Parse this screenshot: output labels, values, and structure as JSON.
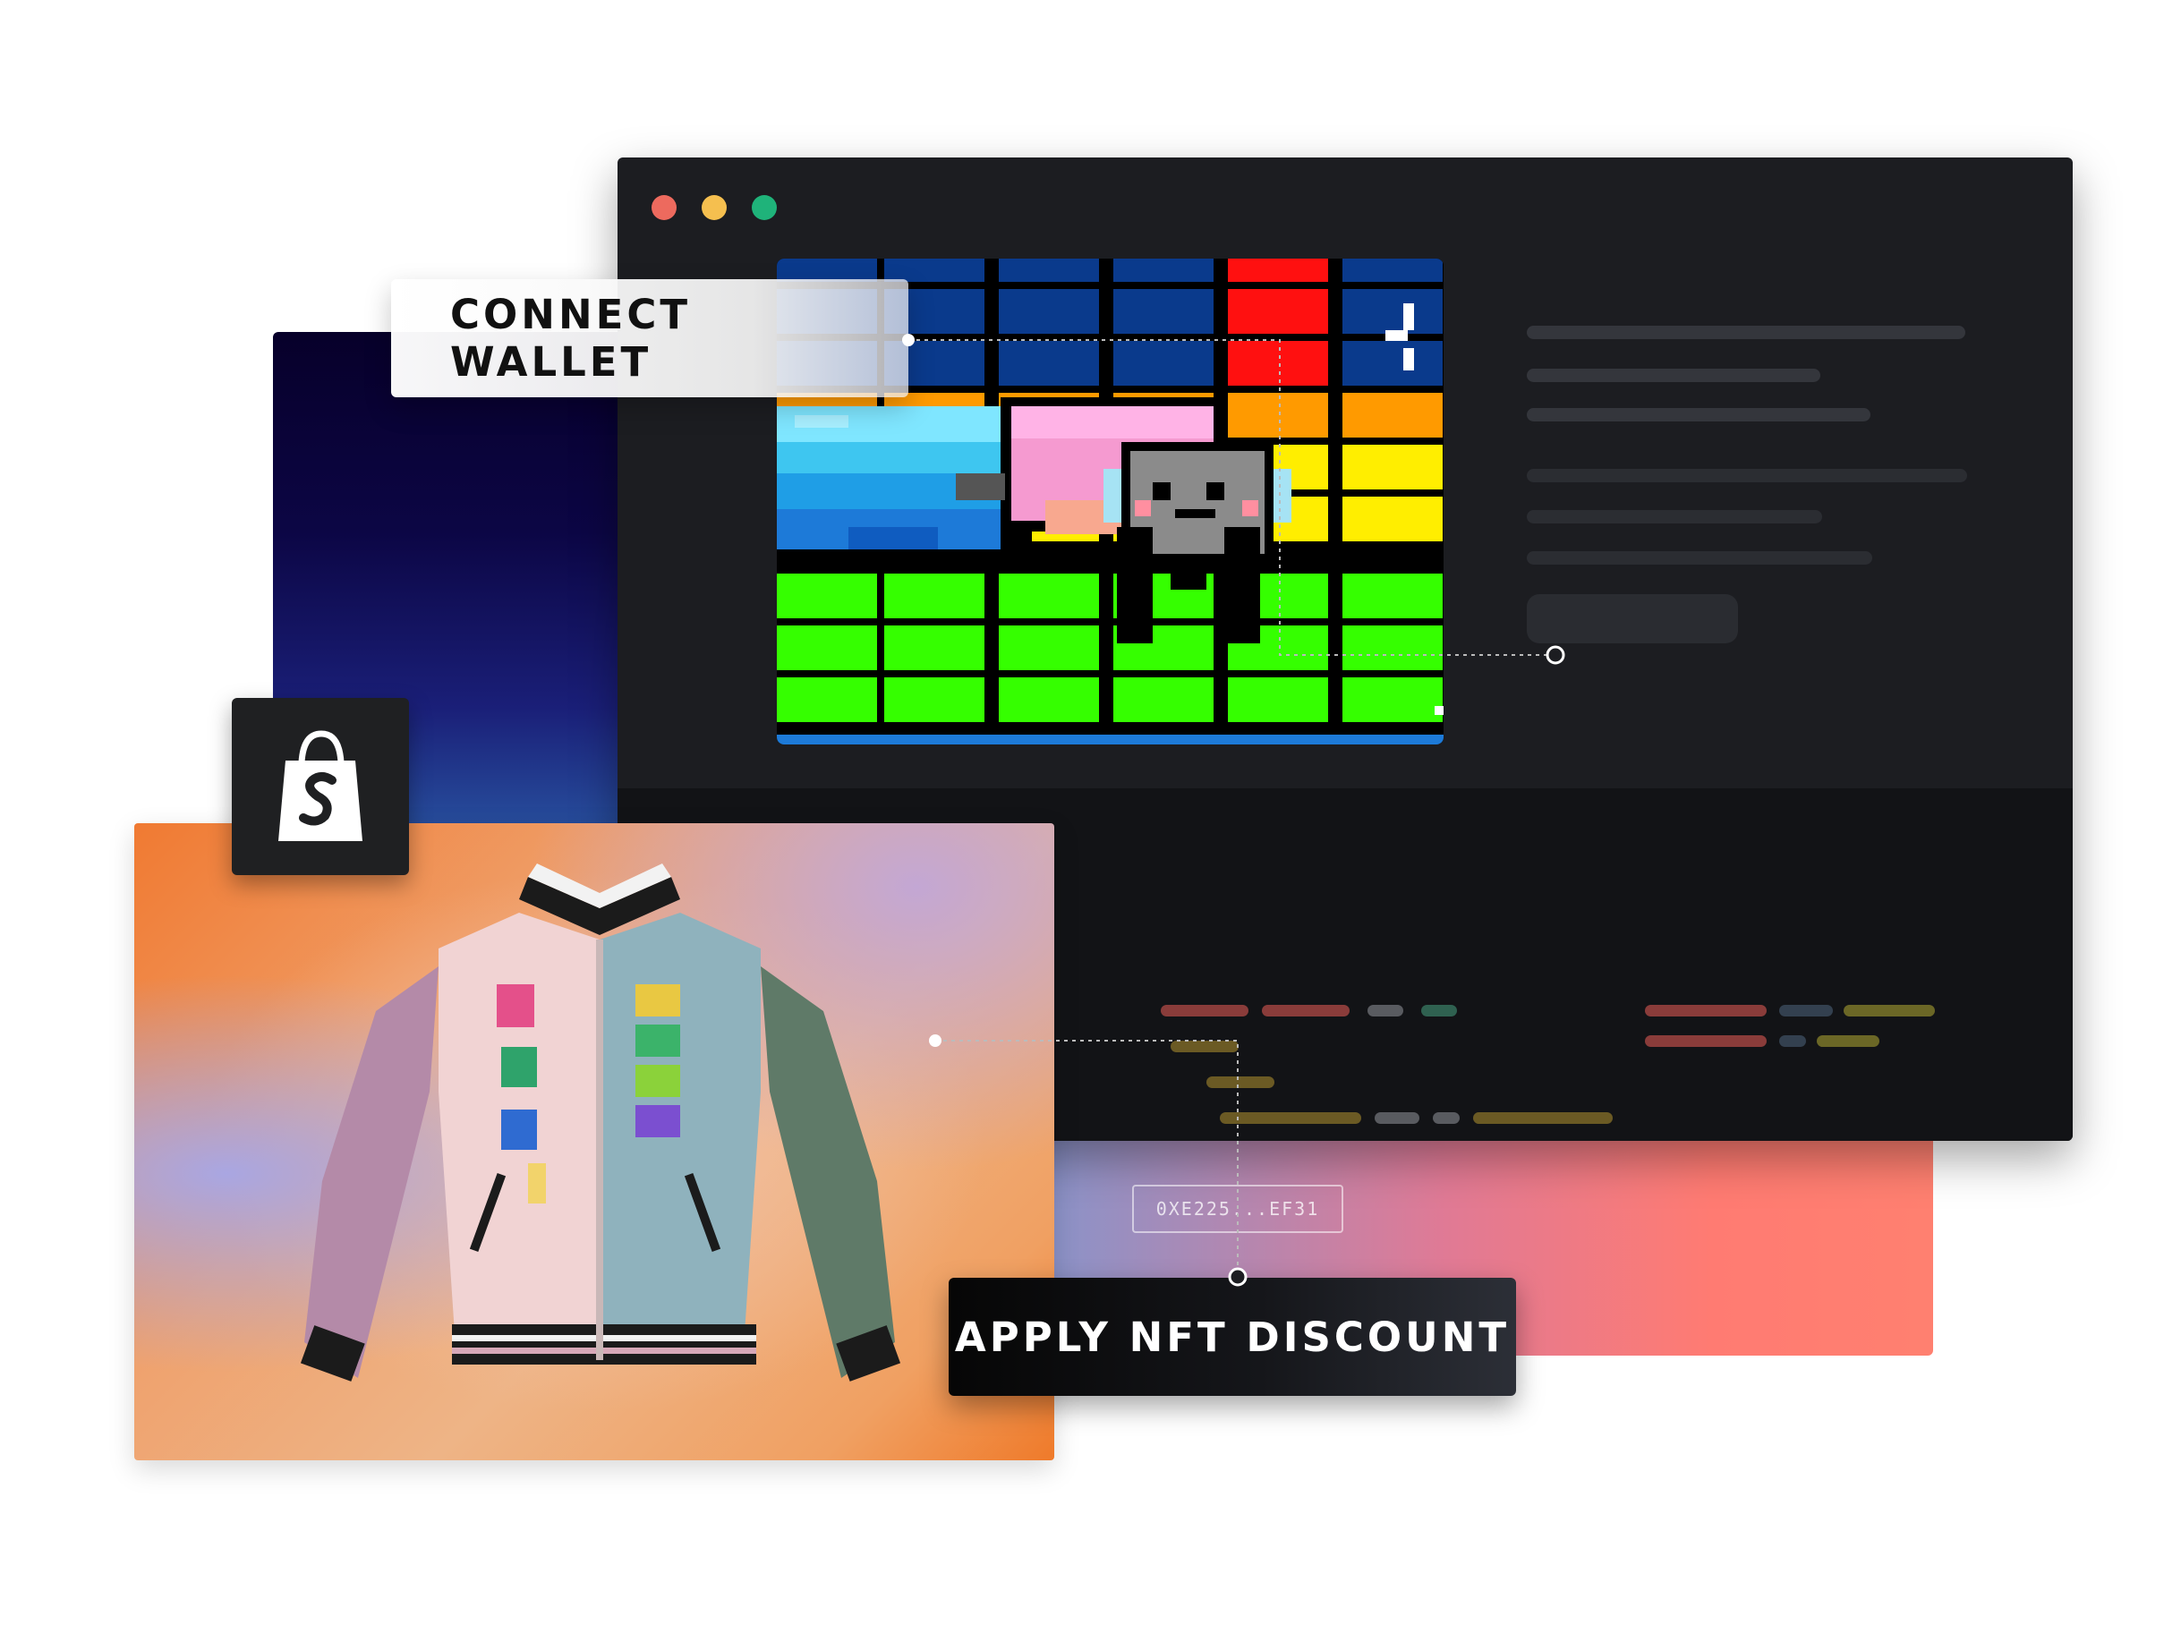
{
  "buttons": {
    "connect_wallet": "CONNECT WALLET",
    "apply_nft_discount": "APPLY NFT DISCOUNT"
  },
  "wallet_address": "0XE225...EF31",
  "window_controls": [
    "close",
    "minimize",
    "maximize"
  ],
  "icons": {
    "shopify": "shopify-bag-icon"
  },
  "colors": {
    "window_close": "#ed6a5e",
    "window_minimize": "#f5bf4f",
    "window_maximize": "#1fb37a",
    "browser_bg": "#1c1d21",
    "code_bg": "#121316"
  }
}
